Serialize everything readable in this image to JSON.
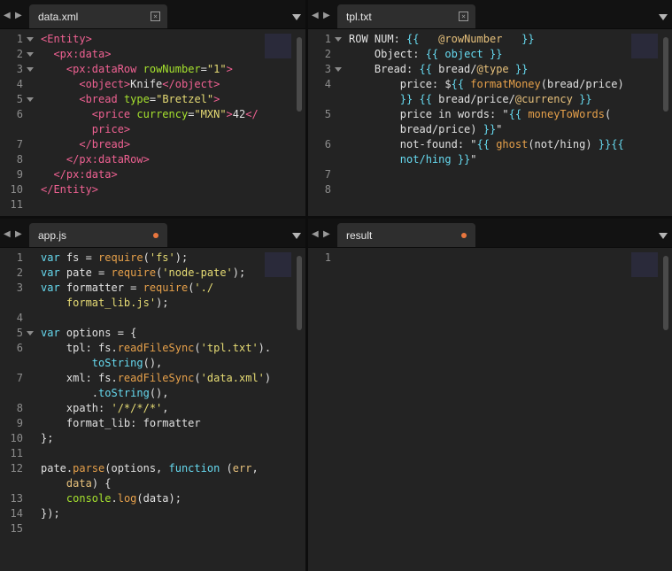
{
  "nav": {
    "left": "◀",
    "right": "▶"
  },
  "panes": [
    {
      "tab": "data.xml",
      "tab_status": "close",
      "close_glyph": "×",
      "lines": [
        {
          "n": "1",
          "f": true,
          "code": "<span class=t>&lt;Entity&gt;</span>"
        },
        {
          "n": "2",
          "f": true,
          "code": "  <span class=t>&lt;px:data&gt;</span>"
        },
        {
          "n": "3",
          "f": true,
          "code": "    <span class=t>&lt;px:dataRow</span> <span class=a>rowNumber</span>=<span class=s>\"1\"</span><span class=t>&gt;</span>"
        },
        {
          "n": "4",
          "f": false,
          "code": "      <span class=t>&lt;object&gt;</span>Knife<span class=t>&lt;/object&gt;</span>"
        },
        {
          "n": "5",
          "f": true,
          "code": "      <span class=t>&lt;bread</span> <span class=a>type</span>=<span class=s>\"Bretzel\"</span><span class=t>&gt;</span>"
        },
        {
          "n": "6",
          "f": false,
          "code": "        <span class=t>&lt;price</span> <span class=a>currency</span>=<span class=s>\"MXN\"</span><span class=t>&gt;</span>42<span class=t>&lt;/</span>"
        },
        {
          "n": "",
          "f": false,
          "code": "        <span class=t>price</span><span class=t>&gt;</span>"
        },
        {
          "n": "7",
          "f": false,
          "code": "      <span class=t>&lt;/bread&gt;</span>"
        },
        {
          "n": "8",
          "f": false,
          "code": "    <span class=t>&lt;/px:dataRow&gt;</span>"
        },
        {
          "n": "9",
          "f": false,
          "code": "  <span class=t>&lt;/px:data&gt;</span>"
        },
        {
          "n": "10",
          "f": false,
          "code": "<span class=t>&lt;/Entity&gt;</span>"
        },
        {
          "n": "11",
          "f": false,
          "code": ""
        }
      ]
    },
    {
      "tab": "tpl.txt",
      "tab_status": "close",
      "close_glyph": "×",
      "lines": [
        {
          "n": "1",
          "f": true,
          "code": "ROW NUM: <span class=k>{{</span>   <span class=n>@rowNumber</span>   <span class=k>}}</span>"
        },
        {
          "n": "2",
          "f": false,
          "code": "    Object: <span class=k>{{</span> <span class=k>object</span> <span class=k>}}</span>"
        },
        {
          "n": "3",
          "f": true,
          "code": "    Bread: <span class=k>{{</span> bread/<span class=n>@type</span> <span class=k>}}</span>"
        },
        {
          "n": "4",
          "f": false,
          "code": "        price: $<span class=k>{{</span> <span class=f>formatMoney</span>(bread/price)"
        },
        {
          "n": "",
          "f": false,
          "code": "        <span class=k>}}</span> <span class=k>{{</span> bread/price/<span class=n>@currency</span> <span class=k>}}</span>"
        },
        {
          "n": "5",
          "f": false,
          "code": "        price in words: \"<span class=k>{{</span> <span class=f>moneyToWords</span>("
        },
        {
          "n": "",
          "f": false,
          "code": "        bread/price) <span class=k>}}</span>\""
        },
        {
          "n": "6",
          "f": false,
          "code": "        not-found: \"<span class=k>{{</span> <span class=f>ghost</span>(not/hing) <span class=k>}}{{</span>"
        },
        {
          "n": "",
          "f": false,
          "code": "        <span class=k>not/hing</span> <span class=k>}}</span>\""
        },
        {
          "n": "7",
          "f": false,
          "code": ""
        },
        {
          "n": "8",
          "f": false,
          "code": ""
        }
      ]
    },
    {
      "tab": "app.js",
      "tab_status": "modified",
      "lines": [
        {
          "n": "1",
          "f": false,
          "code": "<span class=k>var</span> fs = <span class=f>require</span>(<span class=s>'fs'</span>);"
        },
        {
          "n": "2",
          "f": false,
          "code": "<span class=k>var</span> pate = <span class=f>require</span>(<span class=s>'node-pate'</span>);"
        },
        {
          "n": "3",
          "f": false,
          "code": "<span class=k>var</span> formatter = <span class=f>require</span>(<span class=s>'./</span>"
        },
        {
          "n": "",
          "f": false,
          "code": "    <span class=s>format_lib.js'</span>);"
        },
        {
          "n": "4",
          "f": false,
          "code": ""
        },
        {
          "n": "5",
          "f": true,
          "code": "<span class=k>var</span> options = {"
        },
        {
          "n": "6",
          "f": false,
          "code": "    tpl: fs.<span class=f>readFileSync</span>(<span class=s>'tpl.txt'</span>)."
        },
        {
          "n": "",
          "f": false,
          "code": "        <span class=k>toString</span>(),"
        },
        {
          "n": "7",
          "f": false,
          "code": "    xml: fs.<span class=f>readFileSync</span>(<span class=s>'data.xml'</span>)"
        },
        {
          "n": "",
          "f": false,
          "code": "        .<span class=k>toString</span>(),"
        },
        {
          "n": "8",
          "f": false,
          "code": "    xpath: <span class=s>'/*/*/*'</span>,"
        },
        {
          "n": "9",
          "f": false,
          "code": "    format_lib: formatter"
        },
        {
          "n": "10",
          "f": false,
          "code": "};"
        },
        {
          "n": "11",
          "f": false,
          "code": ""
        },
        {
          "n": "12",
          "f": false,
          "code": "pate.<span class=f>parse</span>(options, <span class=k>function</span> (<span class=n>err</span>,"
        },
        {
          "n": "",
          "f": false,
          "code": "    <span class=n>data</span>) {"
        },
        {
          "n": "13",
          "f": false,
          "code": "    <span class=a>console</span>.<span class=f>log</span>(data);"
        },
        {
          "n": "14",
          "f": false,
          "code": "});"
        },
        {
          "n": "15",
          "f": false,
          "code": ""
        }
      ]
    },
    {
      "tab": "result",
      "tab_status": "modified",
      "lines": [
        {
          "n": "1",
          "f": false,
          "code": ""
        }
      ]
    }
  ]
}
